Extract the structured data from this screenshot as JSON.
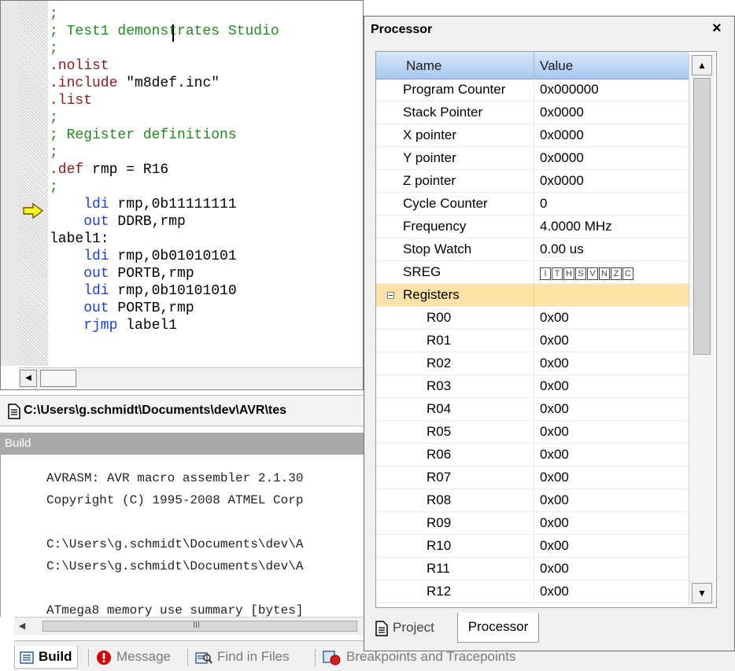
{
  "editor": {
    "lines": [
      {
        "type": "comment",
        "text": ";"
      },
      {
        "type": "comment",
        "text": "; Test1 demonstrates Studio"
      },
      {
        "type": "comment",
        "text": ";"
      },
      {
        "type": "directive",
        "text": ".nolist"
      },
      {
        "type": "mixed",
        "dir": ".include",
        "rest": " \"m8def.inc\""
      },
      {
        "type": "directive",
        "text": ".list"
      },
      {
        "type": "comment",
        "text": ";"
      },
      {
        "type": "comment",
        "text": "; Register definitions"
      },
      {
        "type": "comment",
        "text": ";"
      },
      {
        "type": "mixed",
        "dir": ".def",
        "rest": " rmp = R16"
      },
      {
        "type": "comment",
        "text": ";"
      },
      {
        "type": "instr",
        "kw": "    ldi",
        "rest": " rmp,0b11111111"
      },
      {
        "type": "instr",
        "kw": "    out",
        "rest": " DDRB,rmp"
      },
      {
        "type": "plain",
        "text": "label1:"
      },
      {
        "type": "instr",
        "kw": "    ldi",
        "rest": " rmp,0b01010101"
      },
      {
        "type": "instr",
        "kw": "    out",
        "rest": " PORTB,rmp"
      },
      {
        "type": "instr",
        "kw": "    ldi",
        "rest": " rmp,0b10101010"
      },
      {
        "type": "instr",
        "kw": "    out",
        "rest": " PORTB,rmp"
      },
      {
        "type": "instr",
        "kw": "    rjmp",
        "rest": " label1"
      }
    ],
    "file_path": "C:\\Users\\g.schmidt\\Documents\\dev\\AVR\\tes"
  },
  "build": {
    "title": "Build",
    "lines": [
      "AVRASM: AVR macro assembler 2.1.30",
      "Copyright (C) 1995-2008 ATMEL Corp",
      "",
      "C:\\Users\\g.schmidt\\Documents\\dev\\A",
      "C:\\Users\\g.schmidt\\Documents\\dev\\A",
      "",
      "ATmega8 memory use summary [bytes]"
    ],
    "scroll_grip": "III"
  },
  "bottom_tabs": [
    {
      "label": "Build"
    },
    {
      "label": "Message"
    },
    {
      "label": "Find in Files"
    },
    {
      "label": "Breakpoints and Tracepoints"
    }
  ],
  "processor": {
    "title": "Processor",
    "close": "×",
    "col_name": "Name",
    "col_value": "Value",
    "rows": [
      {
        "name": "Program Counter",
        "value": "0x000000"
      },
      {
        "name": "Stack Pointer",
        "value": "0x0000"
      },
      {
        "name": "X pointer",
        "value": "0x0000"
      },
      {
        "name": "Y pointer",
        "value": "0x0000"
      },
      {
        "name": "Z pointer",
        "value": "0x0000"
      },
      {
        "name": "Cycle Counter",
        "value": "0"
      },
      {
        "name": "Frequency",
        "value": "4.0000 MHz"
      },
      {
        "name": "Stop Watch",
        "value": "0.00 us"
      },
      {
        "name": "SREG",
        "value": ""
      }
    ],
    "sreg_flags": [
      "I",
      "T",
      "H",
      "S",
      "V",
      "N",
      "Z",
      "C"
    ],
    "group_label": "Registers",
    "registers": [
      {
        "name": "R00",
        "value": "0x00"
      },
      {
        "name": "R01",
        "value": "0x00"
      },
      {
        "name": "R02",
        "value": "0x00"
      },
      {
        "name": "R03",
        "value": "0x00"
      },
      {
        "name": "R04",
        "value": "0x00"
      },
      {
        "name": "R05",
        "value": "0x00"
      },
      {
        "name": "R06",
        "value": "0x00"
      },
      {
        "name": "R07",
        "value": "0x00"
      },
      {
        "name": "R08",
        "value": "0x00"
      },
      {
        "name": "R09",
        "value": "0x00"
      },
      {
        "name": "R10",
        "value": "0x00"
      },
      {
        "name": "R11",
        "value": "0x00"
      },
      {
        "name": "R12",
        "value": "0x00"
      }
    ],
    "tabs": [
      {
        "label": "Project"
      },
      {
        "label": "Processor"
      }
    ]
  },
  "colors": {
    "comment": "#1e8b1e",
    "directive": "#8b1a1a",
    "keyword": "#1a3fd1",
    "group_row": "#fde2a6",
    "header": "#a8c8ef",
    "exec_arrow": "#f7f41a"
  },
  "icons": {
    "exec_arrow": "current-instruction-arrow-icon",
    "file": "document-icon",
    "build_tab": "build-list-icon",
    "message_tab": "error-icon",
    "find_tab": "find-in-files-icon",
    "breakpoints_tab": "breakpoints-icon"
  }
}
